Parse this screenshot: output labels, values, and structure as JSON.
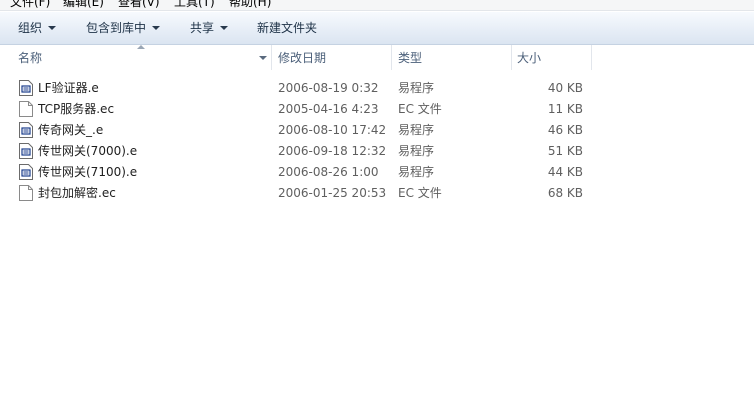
{
  "menu": {
    "items": [
      "文件(F)",
      "编辑(E)",
      "查看(V)",
      "工具(T)",
      "帮助(H)"
    ]
  },
  "toolbar": {
    "organize_label": "组织",
    "include_library_label": "包含到库中",
    "share_label": "共享",
    "new_folder_label": "新建文件夹"
  },
  "columns": {
    "name": "名称",
    "date_modified": "修改日期",
    "type": "类型",
    "size": "大小"
  },
  "files": [
    {
      "name": "LF验证器.e",
      "date": "2006-08-19 0:32",
      "type": "易程序",
      "size": "40 KB",
      "icon": "e-program-icon"
    },
    {
      "name": "TCP服务器.ec",
      "date": "2005-04-16 4:23",
      "type": "EC 文件",
      "size": "11 KB",
      "icon": "generic-file-icon"
    },
    {
      "name": "传奇网关_.e",
      "date": "2006-08-10 17:42",
      "type": "易程序",
      "size": "46 KB",
      "icon": "e-program-icon"
    },
    {
      "name": "传世网关(7000).e",
      "date": "2006-09-18 12:32",
      "type": "易程序",
      "size": "51 KB",
      "icon": "e-program-icon"
    },
    {
      "name": "传世网关(7100).e",
      "date": "2006-08-26 1:00",
      "type": "易程序",
      "size": "44 KB",
      "icon": "e-program-icon"
    },
    {
      "name": "封包加解密.ec",
      "date": "2006-01-25 20:53",
      "type": "EC 文件",
      "size": "68 KB",
      "icon": "generic-file-icon"
    }
  ]
}
